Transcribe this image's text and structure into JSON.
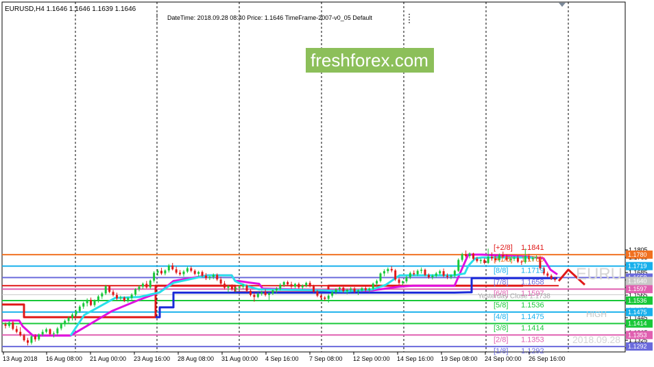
{
  "header": {
    "symbol_label": "EURUSD,H4  1.1646 1.1646 1.1639 1.1646",
    "info_text": "DateTime: 2018.09.28 08:40   Price: 1.1646   TimeFrame-2007-v0_05   Default"
  },
  "watermark": {
    "text": "freshforex.com",
    "bg": "#8cbf5a"
  },
  "side_labels": {
    "symbol": "EURU",
    "high": "HIGH",
    "date": "2018.09.28"
  },
  "chart_data": {
    "type": "line",
    "title": "",
    "xlabel": "",
    "ylabel": "",
    "ylim": [
      1.1275,
      1.1835
    ],
    "grid": false,
    "x_ticks": [
      "13 Aug 2018",
      "16 Aug 08:00",
      "21 Aug 00:00",
      "23 Aug 16:00",
      "28 Aug 08:00",
      "31 Aug 00:00",
      "4 Sep 16:00",
      "7 Sep 08:00",
      "12 Sep 00:00",
      "14 Sep 16:00",
      "19 Sep 08:00",
      "24 Sep 00:00",
      "26 Sep 16:00"
    ],
    "y_ticks": [
      "1.1805",
      "1.1765",
      "1.1725",
      "1.1685",
      "1.1645",
      "1.1605",
      "1.1565",
      "1.1525",
      "1.1485",
      "1.1445",
      "1.1405",
      "1.1365",
      "1.1325",
      "1.1285"
    ],
    "murrey_levels": [
      {
        "label": "[+2/8]",
        "value": 1.1841,
        "price_text": "1.1841",
        "color": "#e01818",
        "tag": false
      },
      {
        "label": "[+1/8]",
        "value": 1.178,
        "price_text": "1.1780",
        "color": "#f07020",
        "tag": true
      },
      {
        "label": "[8/8]",
        "value": 1.1719,
        "price_text": "1.1719",
        "color": "#18b0ec",
        "tag": true
      },
      {
        "label": "[7/8]",
        "value": 1.1658,
        "price_text": "1.1658",
        "color": "#6a6adc",
        "tag": true
      },
      {
        "label": "[6/8]",
        "value": 1.1597,
        "price_text": "1.1597",
        "color": "#e060b0",
        "tag": true
      },
      {
        "label": "[5/8]",
        "value": 1.1536,
        "price_text": "1.1536",
        "color": "#18c838",
        "tag": true
      },
      {
        "label": "[4/8]",
        "value": 1.1475,
        "price_text": "1.1475",
        "color": "#18b0ec",
        "tag": true
      },
      {
        "label": "[3/8]",
        "value": 1.1414,
        "price_text": "1.1414",
        "color": "#18c838",
        "tag": true
      },
      {
        "label": "[2/8]",
        "value": 1.1353,
        "price_text": "1.1353",
        "color": "#e060b0",
        "tag": true
      },
      {
        "label": "[1/8]",
        "value": 1.1292,
        "price_text": "1.1292",
        "color": "#6a6adc",
        "tag": true
      }
    ],
    "current_price": {
      "value": 1.164,
      "text": "1.1640"
    },
    "yesterday_close": {
      "label": "Yesterday Close",
      "value": 1.1738,
      "text": "1.1738"
    },
    "red_level": 1.1615,
    "series": [
      {
        "color": "#e01818",
        "x": [
          0,
          32,
          32,
          224,
          224,
          340,
          340,
          476,
          476,
          760
        ],
        "y": [
          1.1515,
          1.1515,
          1.1448,
          1.1448,
          1.1615,
          1.1615,
          1.158,
          1.158,
          1.1615,
          1.1615
        ]
      },
      {
        "color": "#1a2ad8",
        "x": [
          224,
          230,
          230,
          250,
          250,
          460,
          460,
          660,
          680,
          685,
          685,
          810
        ],
        "y": [
          1.1448,
          1.1448,
          1.15,
          1.15,
          1.1578,
          1.1578,
          1.1578,
          1.1578,
          1.158,
          1.158,
          1.1655,
          1.1655
        ]
      },
      {
        "color": "#e010e0",
        "x": [
          0,
          25,
          30,
          45,
          55,
          65,
          75,
          95,
          100,
          160,
          200,
          230,
          250,
          300,
          320,
          335,
          340,
          345,
          360,
          375,
          380,
          470,
          500,
          540,
          560,
          580,
          600,
          660,
          680,
          700,
          760,
          765,
          770,
          790,
          800,
          810
        ],
        "y": [
          1.143,
          1.143,
          1.14,
          1.135,
          1.135,
          1.135,
          1.135,
          1.135,
          1.135,
          1.148,
          1.154,
          1.158,
          1.164,
          1.167,
          1.167,
          1.167,
          1.164,
          1.164,
          1.1632,
          1.1625,
          1.16,
          1.159,
          1.1588,
          1.159,
          1.16,
          1.161,
          1.1615,
          1.1615,
          1.178,
          1.178,
          1.177,
          1.177,
          1.1768,
          1.176,
          1.17,
          1.1675
        ]
      },
      {
        "color": "#28e0ea",
        "x": [
          100,
          120,
          140,
          165,
          200,
          230,
          250,
          300,
          335,
          340,
          345,
          360,
          375,
          380,
          470,
          500,
          540,
          560,
          580,
          600,
          660,
          675,
          680,
          690,
          700,
          760,
          770,
          780
        ],
        "y": [
          1.135,
          1.146,
          1.15,
          1.155,
          1.1555,
          1.158,
          1.163,
          1.167,
          1.167,
          1.164,
          1.163,
          1.161,
          1.1595,
          1.1595,
          1.159,
          1.1585,
          1.1595,
          1.162,
          1.167,
          1.167,
          1.167,
          1.168,
          1.172,
          1.176,
          1.1765,
          1.1765,
          1.1765,
          1.1765
        ]
      },
      {
        "color": "#e01818",
        "x": [
          812,
          826,
          850
        ],
        "y": [
          1.164,
          1.17,
          1.162
        ]
      }
    ],
    "candles": [
      [
        1.141,
        1.142,
        1.1388,
        1.1402
      ],
      [
        1.1402,
        1.1428,
        1.1392,
        1.142
      ],
      [
        1.142,
        1.1428,
        1.1378,
        1.1385
      ],
      [
        1.1385,
        1.1402,
        1.1362,
        1.137
      ],
      [
        1.137,
        1.1395,
        1.1345,
        1.1352
      ],
      [
        1.1352,
        1.136,
        1.1318,
        1.1325
      ],
      [
        1.1325,
        1.1338,
        1.1298,
        1.1312
      ],
      [
        1.1312,
        1.1352,
        1.1302,
        1.1346
      ],
      [
        1.1346,
        1.1358,
        1.1318,
        1.133
      ],
      [
        1.133,
        1.1362,
        1.1322,
        1.1356
      ],
      [
        1.1356,
        1.1382,
        1.1346,
        1.137
      ],
      [
        1.137,
        1.1392,
        1.1362,
        1.1384
      ],
      [
        1.1384,
        1.1388,
        1.135,
        1.1358
      ],
      [
        1.1358,
        1.1372,
        1.134,
        1.1362
      ],
      [
        1.1362,
        1.1396,
        1.1352,
        1.1388
      ],
      [
        1.1388,
        1.1418,
        1.1378,
        1.141
      ],
      [
        1.141,
        1.1436,
        1.1398,
        1.1428
      ],
      [
        1.1428,
        1.1452,
        1.1412,
        1.1445
      ],
      [
        1.1445,
        1.147,
        1.143,
        1.1462
      ],
      [
        1.1462,
        1.1488,
        1.1448,
        1.148
      ],
      [
        1.148,
        1.1512,
        1.147,
        1.1504
      ],
      [
        1.1504,
        1.153,
        1.1492,
        1.1522
      ],
      [
        1.1522,
        1.1548,
        1.1505,
        1.154
      ],
      [
        1.154,
        1.1552,
        1.1506,
        1.1512
      ],
      [
        1.1512,
        1.1542,
        1.1502,
        1.1536
      ],
      [
        1.1536,
        1.1566,
        1.1525,
        1.1558
      ],
      [
        1.1558,
        1.1582,
        1.1545,
        1.1574
      ],
      [
        1.1574,
        1.162,
        1.1565,
        1.1612
      ],
      [
        1.1612,
        1.1618,
        1.1575,
        1.1582
      ],
      [
        1.1582,
        1.1592,
        1.1558,
        1.1566
      ],
      [
        1.1566,
        1.1578,
        1.1538,
        1.1548
      ],
      [
        1.1548,
        1.1562,
        1.1536,
        1.1552
      ],
      [
        1.1552,
        1.1558,
        1.1528,
        1.1535
      ],
      [
        1.1535,
        1.1556,
        1.1525,
        1.155
      ],
      [
        1.155,
        1.1575,
        1.154,
        1.1568
      ],
      [
        1.1568,
        1.1602,
        1.156,
        1.1596
      ],
      [
        1.1596,
        1.1618,
        1.1585,
        1.161
      ],
      [
        1.161,
        1.1632,
        1.1598,
        1.1625
      ],
      [
        1.1625,
        1.164,
        1.16,
        1.1606
      ],
      [
        1.1606,
        1.1648,
        1.1598,
        1.1642
      ],
      [
        1.1642,
        1.1692,
        1.1632,
        1.1684
      ],
      [
        1.1684,
        1.1702,
        1.1668,
        1.1694
      ],
      [
        1.1694,
        1.171,
        1.1672,
        1.168
      ],
      [
        1.168,
        1.1702,
        1.167,
        1.1696
      ],
      [
        1.1696,
        1.173,
        1.1685,
        1.1722
      ],
      [
        1.1722,
        1.1736,
        1.1696,
        1.1702
      ],
      [
        1.1702,
        1.1716,
        1.1676,
        1.1684
      ],
      [
        1.1684,
        1.1698,
        1.1668,
        1.1676
      ],
      [
        1.1676,
        1.1698,
        1.1664,
        1.169
      ],
      [
        1.169,
        1.1716,
        1.1682,
        1.1708
      ],
      [
        1.1708,
        1.1718,
        1.1686,
        1.1694
      ],
      [
        1.1694,
        1.1702,
        1.167,
        1.1678
      ],
      [
        1.1678,
        1.1694,
        1.1664,
        1.1688
      ],
      [
        1.1688,
        1.1696,
        1.166,
        1.1668
      ],
      [
        1.1668,
        1.1682,
        1.1645,
        1.1655
      ],
      [
        1.1655,
        1.1668,
        1.1645,
        1.1662
      ],
      [
        1.1662,
        1.168,
        1.165,
        1.1672
      ],
      [
        1.1672,
        1.168,
        1.164,
        1.1648
      ],
      [
        1.1648,
        1.1662,
        1.1618,
        1.1626
      ],
      [
        1.1626,
        1.164,
        1.1595,
        1.1604
      ],
      [
        1.1604,
        1.1618,
        1.158,
        1.1612
      ],
      [
        1.1612,
        1.1622,
        1.1588,
        1.1596
      ],
      [
        1.1596,
        1.161,
        1.158,
        1.1603
      ],
      [
        1.1603,
        1.1618,
        1.159,
        1.161
      ],
      [
        1.161,
        1.1626,
        1.1596,
        1.1616
      ],
      [
        1.1616,
        1.1622,
        1.158,
        1.1588
      ],
      [
        1.1588,
        1.1596,
        1.1558,
        1.1566
      ],
      [
        1.1566,
        1.1578,
        1.153,
        1.1555
      ],
      [
        1.1555,
        1.158,
        1.1548,
        1.1572
      ],
      [
        1.1572,
        1.1588,
        1.1562,
        1.158
      ],
      [
        1.158,
        1.1596,
        1.1558,
        1.1566
      ],
      [
        1.1566,
        1.158,
        1.154,
        1.1574
      ],
      [
        1.1574,
        1.1595,
        1.1565,
        1.159
      ],
      [
        1.159,
        1.1608,
        1.1575,
        1.16
      ],
      [
        1.16,
        1.1628,
        1.159,
        1.162
      ],
      [
        1.162,
        1.164,
        1.1608,
        1.1634
      ],
      [
        1.1634,
        1.1642,
        1.1614,
        1.1622
      ],
      [
        1.1622,
        1.1636,
        1.16,
        1.161
      ],
      [
        1.161,
        1.163,
        1.16,
        1.1624
      ],
      [
        1.1624,
        1.1632,
        1.1598,
        1.1606
      ],
      [
        1.1606,
        1.1622,
        1.1595,
        1.1616
      ],
      [
        1.1616,
        1.1636,
        1.1606,
        1.163
      ],
      [
        1.163,
        1.164,
        1.1605,
        1.1612
      ],
      [
        1.1612,
        1.162,
        1.1576,
        1.1584
      ],
      [
        1.1584,
        1.1592,
        1.1554,
        1.1562
      ],
      [
        1.1562,
        1.157,
        1.154,
        1.1552
      ],
      [
        1.1552,
        1.156,
        1.1535,
        1.1545
      ],
      [
        1.1545,
        1.157,
        1.1525,
        1.1562
      ],
      [
        1.1562,
        1.1588,
        1.1552,
        1.158
      ],
      [
        1.158,
        1.1602,
        1.157,
        1.1596
      ],
      [
        1.1596,
        1.161,
        1.1584,
        1.1605
      ],
      [
        1.1605,
        1.1612,
        1.1578,
        1.1586
      ],
      [
        1.1586,
        1.16,
        1.157,
        1.1594
      ],
      [
        1.1594,
        1.1608,
        1.158,
        1.16
      ],
      [
        1.16,
        1.1608,
        1.1575,
        1.1584
      ],
      [
        1.1584,
        1.1596,
        1.1565,
        1.159
      ],
      [
        1.159,
        1.1608,
        1.1582,
        1.1602
      ],
      [
        1.1602,
        1.1612,
        1.1584,
        1.1592
      ],
      [
        1.1592,
        1.1606,
        1.158,
        1.16
      ],
      [
        1.16,
        1.1632,
        1.1592,
        1.1626
      ],
      [
        1.1626,
        1.1648,
        1.1612,
        1.164
      ],
      [
        1.164,
        1.1686,
        1.1632,
        1.168
      ],
      [
        1.168,
        1.1702,
        1.1665,
        1.1692
      ],
      [
        1.1692,
        1.1712,
        1.168,
        1.1704
      ],
      [
        1.1704,
        1.1718,
        1.1686,
        1.1696
      ],
      [
        1.1696,
        1.1704,
        1.164,
        1.1648
      ],
      [
        1.1648,
        1.1656,
        1.162,
        1.163
      ],
      [
        1.163,
        1.1642,
        1.1618,
        1.1638
      ],
      [
        1.1638,
        1.1668,
        1.1628,
        1.166
      ],
      [
        1.166,
        1.169,
        1.165,
        1.1682
      ],
      [
        1.1682,
        1.1696,
        1.1668,
        1.1676
      ],
      [
        1.1676,
        1.1702,
        1.1666,
        1.1694
      ],
      [
        1.1694,
        1.1712,
        1.168,
        1.17
      ],
      [
        1.17,
        1.1706,
        1.1665,
        1.1672
      ],
      [
        1.1672,
        1.168,
        1.1652,
        1.166
      ],
      [
        1.166,
        1.1676,
        1.1648,
        1.1668
      ],
      [
        1.1668,
        1.1688,
        1.1658,
        1.168
      ],
      [
        1.168,
        1.17,
        1.167,
        1.1692
      ],
      [
        1.1692,
        1.1706,
        1.166,
        1.1668
      ],
      [
        1.1668,
        1.168,
        1.165,
        1.1662
      ],
      [
        1.1662,
        1.1676,
        1.165,
        1.167
      ],
      [
        1.167,
        1.17,
        1.166,
        1.1694
      ],
      [
        1.1694,
        1.176,
        1.1688,
        1.1752
      ],
      [
        1.1752,
        1.179,
        1.1742,
        1.1782
      ],
      [
        1.1782,
        1.1802,
        1.1764,
        1.1772
      ],
      [
        1.1772,
        1.1792,
        1.176,
        1.1786
      ],
      [
        1.1786,
        1.179,
        1.175,
        1.1758
      ],
      [
        1.1758,
        1.1768,
        1.1738,
        1.1746
      ],
      [
        1.1746,
        1.176,
        1.1732,
        1.1752
      ],
      [
        1.1752,
        1.1762,
        1.1728,
        1.1736
      ],
      [
        1.1736,
        1.1812,
        1.173,
        1.1768
      ],
      [
        1.1768,
        1.1792,
        1.1748,
        1.176
      ],
      [
        1.176,
        1.1775,
        1.174,
        1.175
      ],
      [
        1.175,
        1.1786,
        1.174,
        1.1778
      ],
      [
        1.1778,
        1.1796,
        1.1762,
        1.177
      ],
      [
        1.177,
        1.1782,
        1.1744,
        1.1752
      ],
      [
        1.1752,
        1.1766,
        1.174,
        1.1758
      ],
      [
        1.1758,
        1.1772,
        1.1746,
        1.1764
      ],
      [
        1.1764,
        1.1776,
        1.1735,
        1.1742
      ],
      [
        1.1742,
        1.175,
        1.1725,
        1.174
      ],
      [
        1.174,
        1.1812,
        1.1732,
        1.1772
      ],
      [
        1.1772,
        1.1784,
        1.1748,
        1.1756
      ],
      [
        1.1756,
        1.1772,
        1.1745,
        1.1762
      ],
      [
        1.1762,
        1.1776,
        1.175,
        1.1768
      ],
      [
        1.1768,
        1.1774,
        1.17,
        1.1708
      ],
      [
        1.1708,
        1.1716,
        1.167,
        1.168
      ],
      [
        1.168,
        1.169,
        1.166,
        1.1668
      ],
      [
        1.1668,
        1.1676,
        1.1645,
        1.1652
      ],
      [
        1.1652,
        1.1662,
        1.1636,
        1.1646
      ]
    ]
  }
}
